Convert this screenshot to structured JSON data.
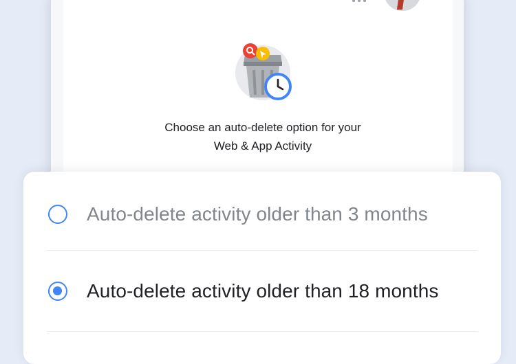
{
  "header": {
    "more_icon": "more-horiz-icon",
    "avatar_icon": "profile-avatar"
  },
  "hero": {
    "icon": "auto-delete-trash-clock-icon",
    "prompt_line1": "Choose an auto-delete option for your",
    "prompt_line2": "Web & App Activity"
  },
  "options": [
    {
      "label": "Auto-delete activity older than 3 months",
      "selected": false
    },
    {
      "label": "Auto-delete activity older than 18 months",
      "selected": true
    }
  ],
  "colors": {
    "accent": "#4285f4",
    "page_background": "#e5ebf7",
    "muted_text": "#80868b",
    "primary_text": "#202124"
  }
}
